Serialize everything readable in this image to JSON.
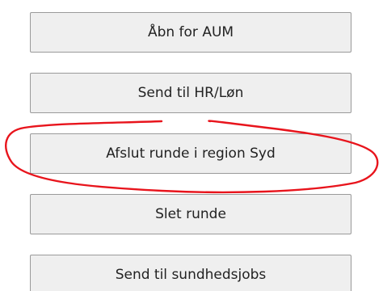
{
  "buttons": [
    {
      "label": "Åbn for AUM"
    },
    {
      "label": "Send til HR/Løn"
    },
    {
      "label": "Afslut runde i region Syd"
    },
    {
      "label": "Slet runde"
    },
    {
      "label": "Send til sundhedsjobs"
    }
  ],
  "annotation": {
    "color": "#e8141c",
    "shape": "hand-drawn ellipse",
    "highlights": "Afslut runde i region Syd"
  }
}
